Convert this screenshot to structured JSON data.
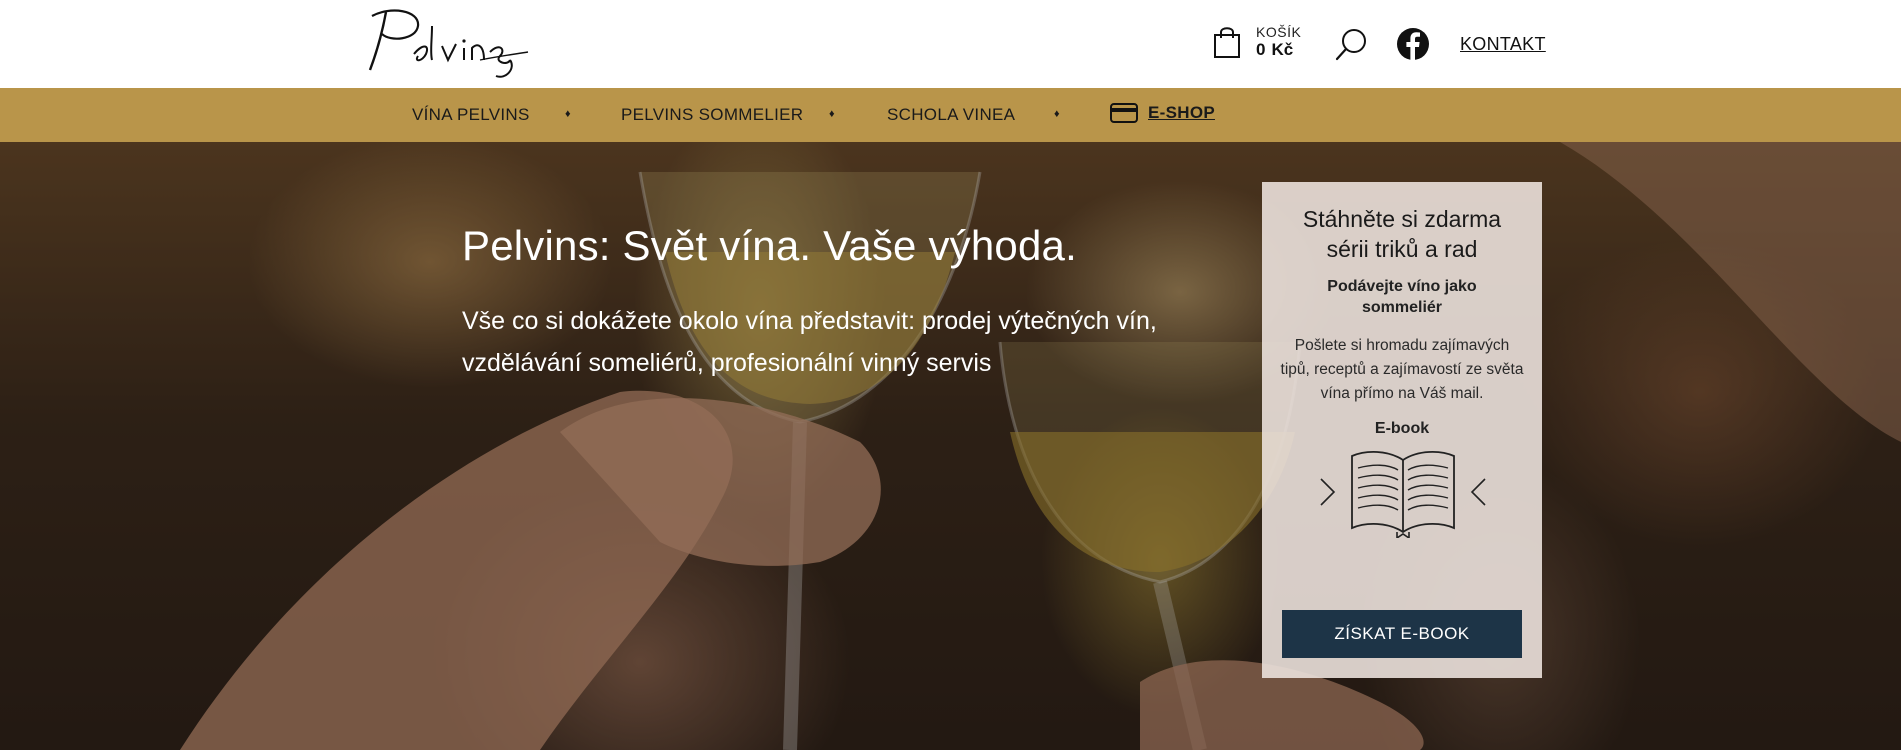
{
  "brand": {
    "logo_text": "Pelvins"
  },
  "header": {
    "cart_label": "KOŠÍK",
    "cart_amount": "0",
    "cart_currency": "Kč",
    "contact_label": "KONTAKT"
  },
  "nav": {
    "items": [
      {
        "label": "VÍNA PELVINS"
      },
      {
        "label": "PELVINS SOMMELIER"
      },
      {
        "label": "SCHOLA VINEA"
      },
      {
        "label": "E-SHOP"
      }
    ],
    "separator": "♦"
  },
  "hero": {
    "title": "Pelvins: Svět vína. Vaše výhoda.",
    "subtitle": "Vše co si dokážete okolo vína představit: prodej výtečných vín, vzdělávání someliérů, profesionální vinný servis"
  },
  "ebook_panel": {
    "title": "Stáhněte si zdarma sérii triků a rad",
    "subtitle": "Podávejte víno jako sommeliér",
    "text": "Pošlete si hromadu zajímavých tipů, receptů a zajímavostí ze světa vína přímo na Váš mail.",
    "label": "E-book",
    "button_label": "ZÍSKAT E-BOOK"
  },
  "colors": {
    "nav_background": "#b9954a",
    "button_background": "#1d3447",
    "panel_background": "#ebe1dc"
  },
  "icons": [
    "logo",
    "shopping-bag-icon",
    "search-icon",
    "facebook-icon",
    "credit-card-icon",
    "open-book-icon",
    "chevron-left-icon",
    "chevron-right-icon"
  ]
}
